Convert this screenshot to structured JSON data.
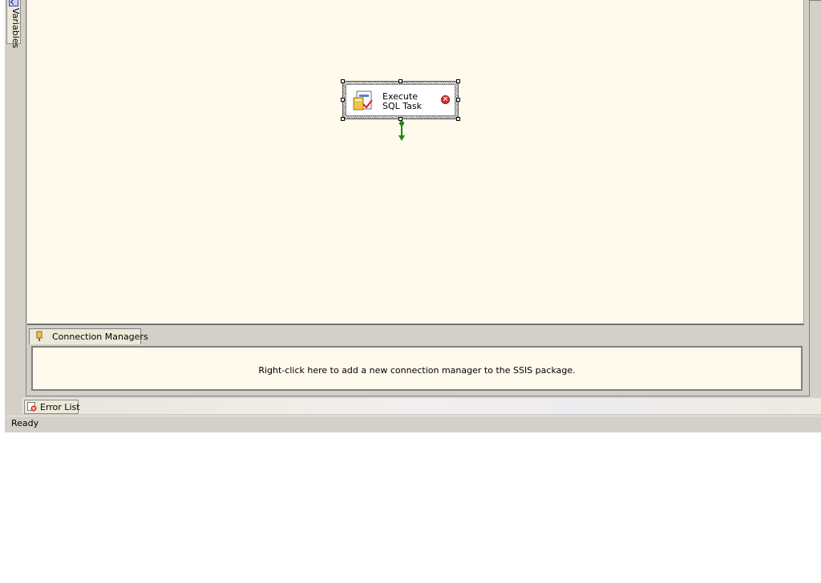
{
  "left_panel": {
    "variables_tab_label": "Variables"
  },
  "designer": {
    "task": {
      "line1": "Execute",
      "line2": "SQL Task",
      "status_icon": "error-icon"
    }
  },
  "connection_managers": {
    "tab_label": "Connection Managers",
    "hint": "Right-click here to add a new connection manager to the SSIS package."
  },
  "bottom_tabs": {
    "error_list_label": "Error List"
  },
  "status_bar": {
    "text": "Ready"
  },
  "colors": {
    "canvas": "#fffaec",
    "chrome": "#d4d0c8",
    "success_connector": "#1a8a1a",
    "error": "#d8312f"
  }
}
